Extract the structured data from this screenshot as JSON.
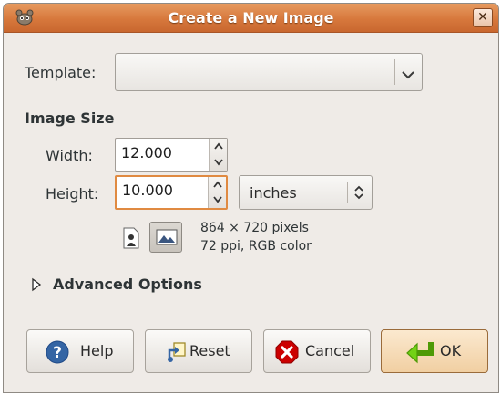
{
  "window": {
    "title": "Create a New Image"
  },
  "template": {
    "label": "Template:",
    "value": ""
  },
  "image_size": {
    "heading": "Image Size",
    "width": {
      "label": "Width:",
      "value": "12.000"
    },
    "height": {
      "label": "Height:",
      "value": "10.000"
    },
    "unit": "inches",
    "info_pixels": "864 × 720 pixels",
    "info_color": "72 ppi, RGB color"
  },
  "advanced": {
    "label": "Advanced Options",
    "expanded": false
  },
  "buttons": {
    "help": "Help",
    "reset": "Reset",
    "cancel": "Cancel",
    "ok": "OK"
  },
  "colors": {
    "title_bar": "#d7783c",
    "ok_button": "#f1cfa2",
    "focus": "#e08a41"
  }
}
